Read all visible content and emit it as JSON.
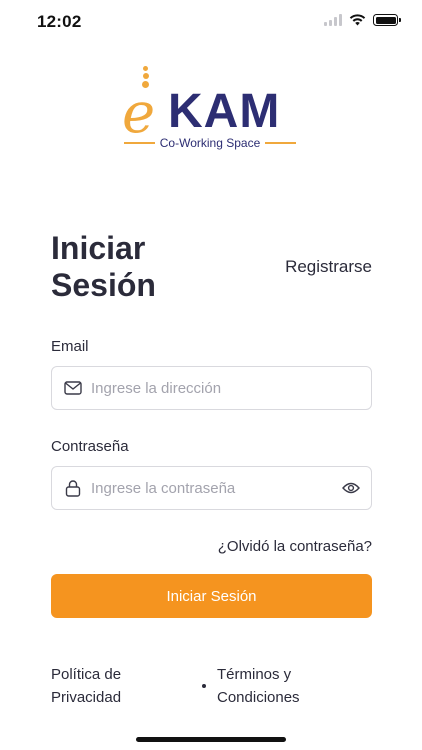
{
  "status_bar": {
    "time": "12:02",
    "icons": [
      "signal-icon",
      "wifi-icon",
      "battery-icon"
    ]
  },
  "logo": {
    "brand_e": "e",
    "brand_name": "KAM",
    "tagline": "Co-Working Space",
    "colors": {
      "accent": "#f0a83c",
      "navy": "#2d2e73"
    }
  },
  "header": {
    "title_line1": "Iniciar",
    "title_line2": "Sesión",
    "register_label": "Registrarse"
  },
  "form": {
    "email_label": "Email",
    "email_placeholder": "Ingrese la dirección",
    "email_icon": "mail-icon",
    "password_label": "Contraseña",
    "password_placeholder": "Ingrese la contraseña",
    "password_icon": "lock-icon",
    "toggle_icon": "eye-icon",
    "forgot_label": "¿Olvidó la contraseña?",
    "submit_label": "Iniciar Sesión"
  },
  "footer": {
    "privacy_line1": "Política de",
    "privacy_line2": "Privacidad",
    "terms_line1": "Términos y",
    "terms_line2": "Condiciones"
  },
  "theme": {
    "primary": "#f5941f",
    "text": "#2b2b3a",
    "border": "#d9d9de",
    "placeholder": "#a3a3ad"
  }
}
